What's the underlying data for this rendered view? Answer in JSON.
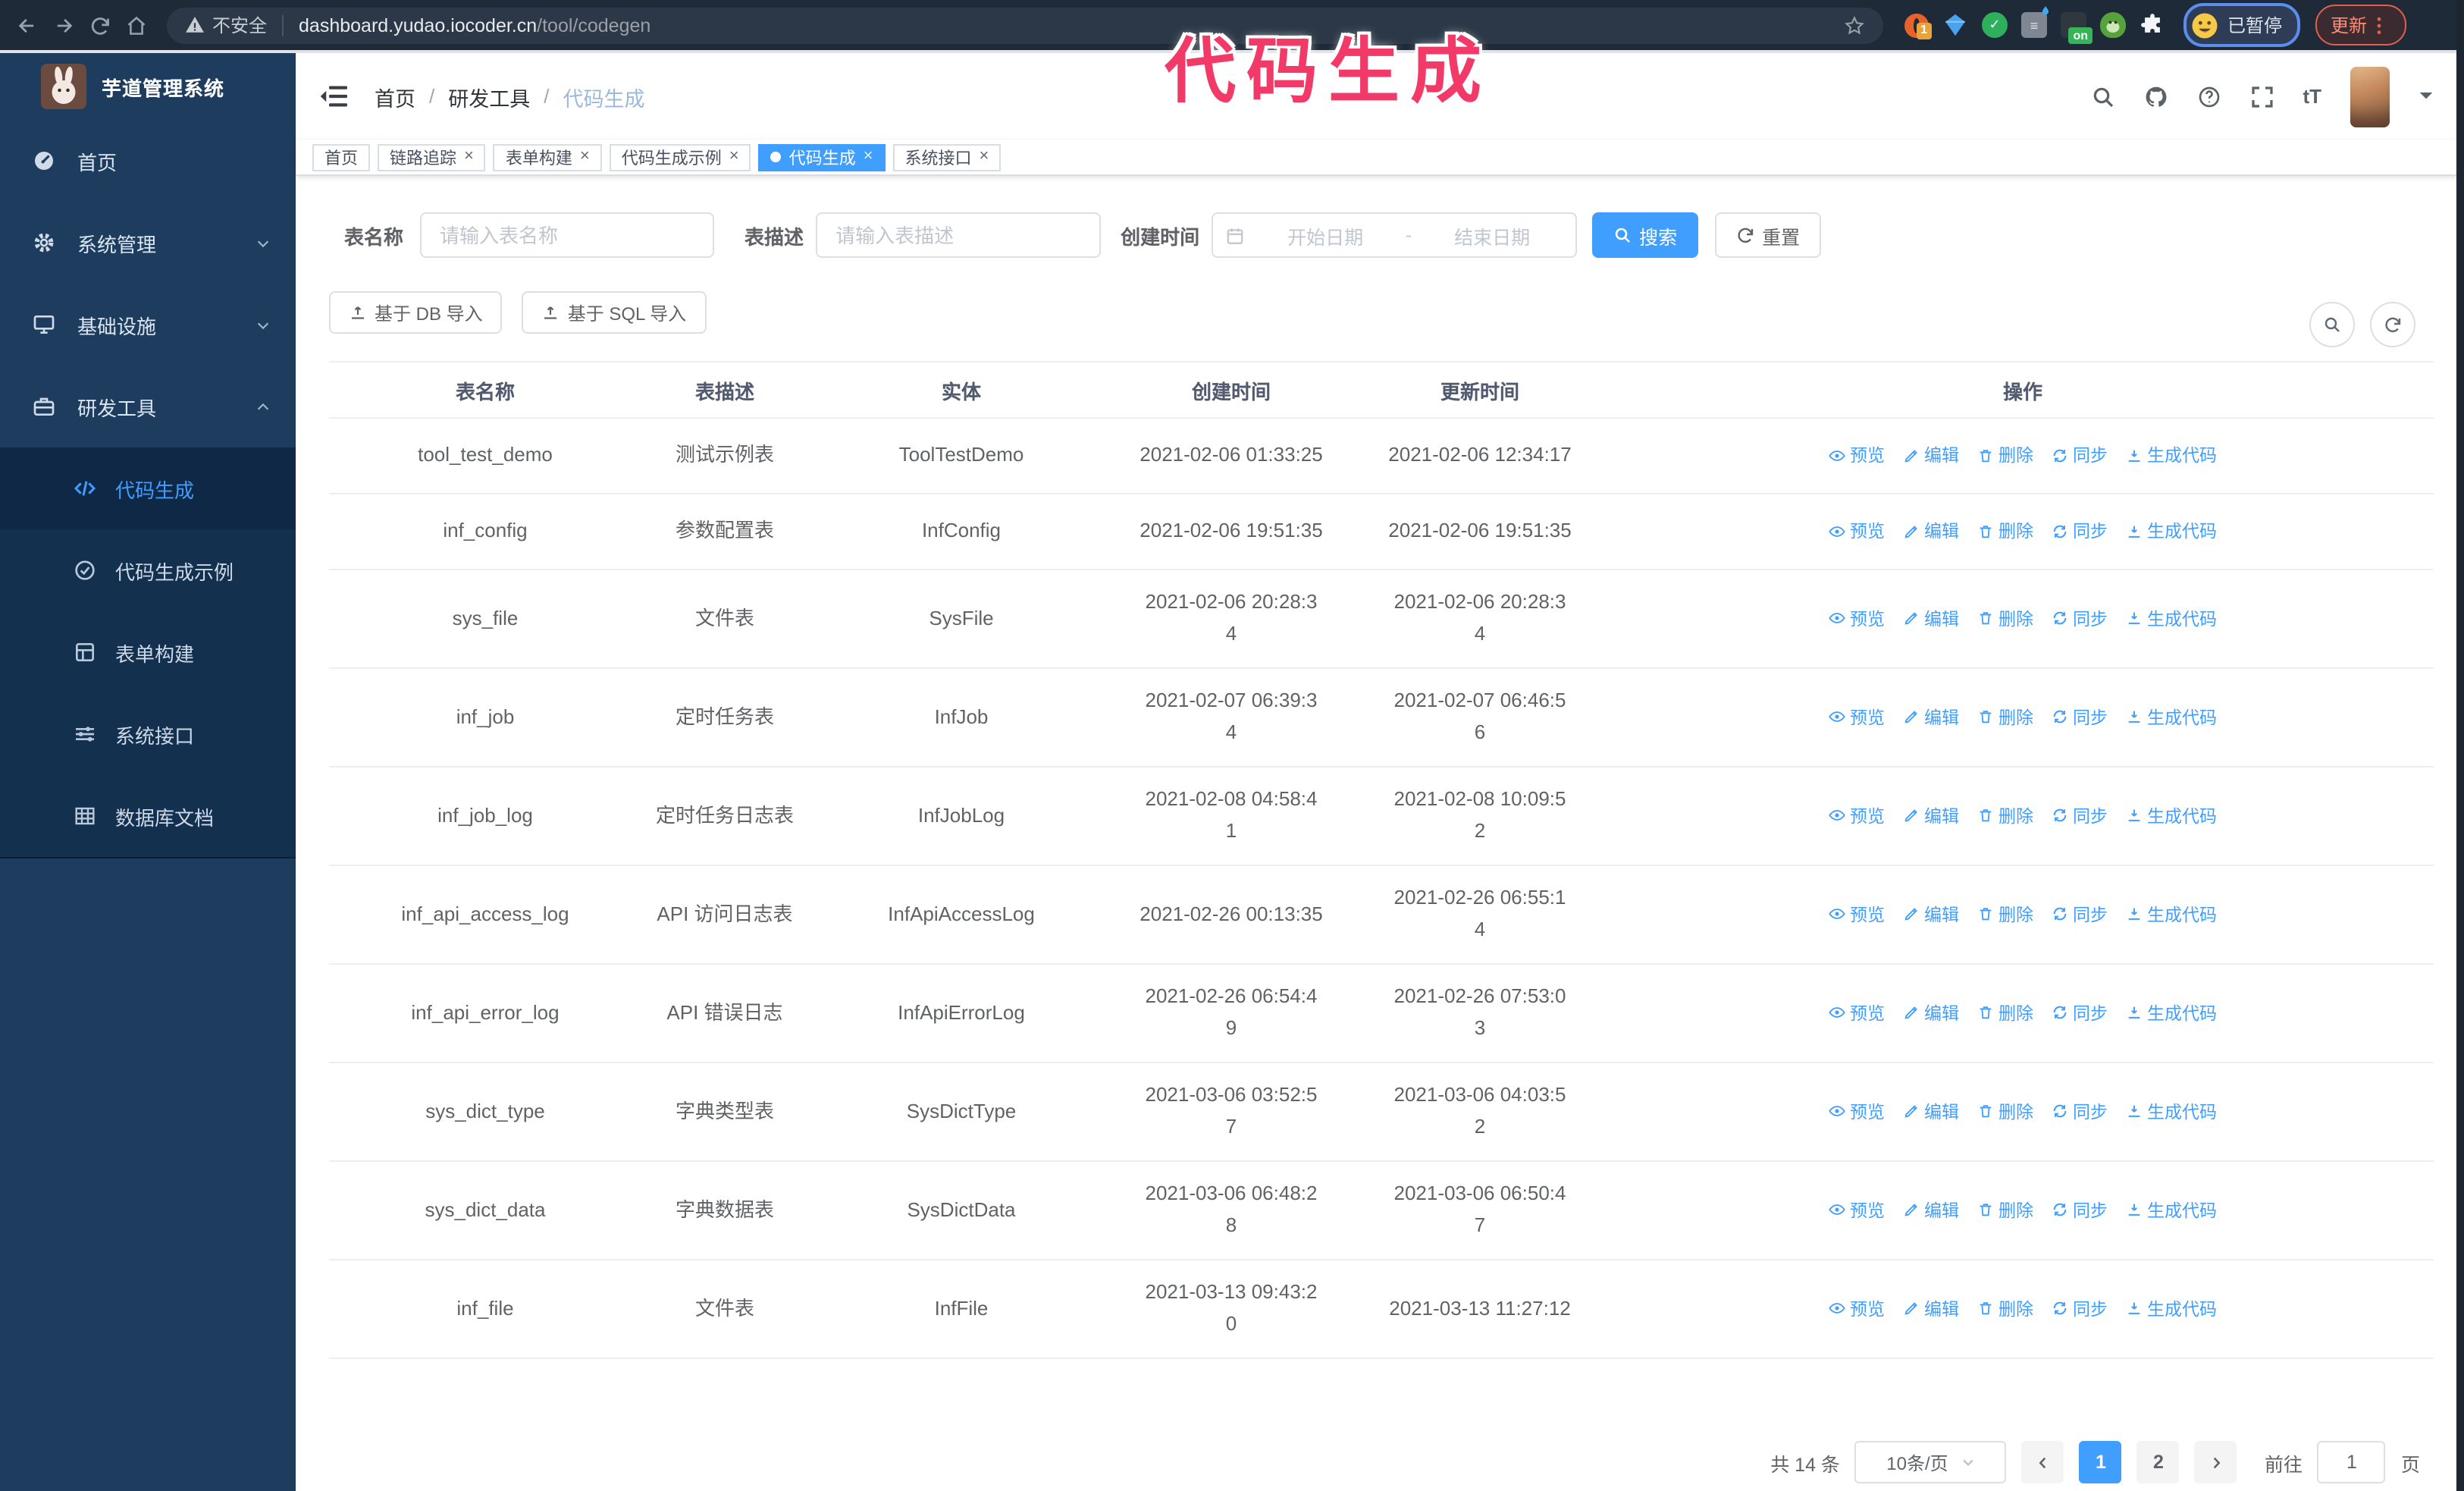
{
  "overlay": {
    "text": "代码生成",
    "color": "#f23a68"
  },
  "browser": {
    "security_label": "不安全",
    "url_host": "dashboard.yudao.iocoder.cn",
    "url_path": "/tool/codegen",
    "profile_chip": "已暂停",
    "update_button": "更新",
    "extensions": [
      {
        "name": "orange-ring-extension-icon",
        "kind": "ring",
        "badge": "1"
      },
      {
        "name": "gem-extension-icon",
        "kind": "gem"
      },
      {
        "name": "green-check-extension-icon",
        "kind": "check",
        "glyph": "✓"
      },
      {
        "name": "sliders-extension-icon",
        "kind": "sliders",
        "glyph": "≡"
      },
      {
        "name": "on-badge-extension-icon",
        "kind": "on",
        "badge": "on"
      },
      {
        "name": "monkey-extension-icon",
        "kind": "monkey"
      },
      {
        "name": "puzzle-extension-icon",
        "kind": "puzzle"
      }
    ]
  },
  "sidebar": {
    "logo_title": "芋道管理系统",
    "items": [
      {
        "label": "首页",
        "icon": "dashboard",
        "arrow": ""
      },
      {
        "label": "系统管理",
        "icon": "gear",
        "arrow": "down"
      },
      {
        "label": "基础设施",
        "icon": "infra",
        "arrow": "down"
      },
      {
        "label": "研发工具",
        "icon": "tool",
        "arrow": "up"
      }
    ],
    "submenu": [
      {
        "label": "代码生成",
        "icon": "code",
        "active": true
      },
      {
        "label": "代码生成示例",
        "icon": "example",
        "active": false
      },
      {
        "label": "表单构建",
        "icon": "form",
        "active": false
      },
      {
        "label": "系统接口",
        "icon": "api",
        "active": false
      },
      {
        "label": "数据库文档",
        "icon": "dbdoc",
        "active": false
      }
    ]
  },
  "header": {
    "breadcrumb": [
      "首页",
      "研发工具",
      "代码生成"
    ],
    "separator": "/"
  },
  "tags": [
    {
      "label": "首页",
      "active": false,
      "closable": false
    },
    {
      "label": "链路追踪",
      "active": false,
      "closable": true
    },
    {
      "label": "表单构建",
      "active": false,
      "closable": true
    },
    {
      "label": "代码生成示例",
      "active": false,
      "closable": true
    },
    {
      "label": "代码生成",
      "active": true,
      "closable": true
    },
    {
      "label": "系统接口",
      "active": false,
      "closable": true
    }
  ],
  "close_glyph": "×",
  "filters": {
    "name_label": "表名称",
    "name_placeholder": "请输入表名称",
    "desc_label": "表描述",
    "desc_placeholder": "请输入表描述",
    "time_label": "创建时间",
    "start_placeholder": "开始日期",
    "range_separator": "-",
    "end_placeholder": "结束日期",
    "search_label": "搜索",
    "reset_label": "重置"
  },
  "toolbar": {
    "import_db": "基于 DB 导入",
    "import_sql": "基于 SQL 导入"
  },
  "table": {
    "columns": [
      "表名称",
      "表描述",
      "实体",
      "创建时间",
      "更新时间",
      "操作"
    ],
    "operations": [
      {
        "label": "预览",
        "icon": "eye",
        "name": "preview-link"
      },
      {
        "label": "编辑",
        "icon": "edit",
        "name": "edit-link"
      },
      {
        "label": "删除",
        "icon": "trash",
        "name": "delete-link"
      },
      {
        "label": "同步",
        "icon": "sync",
        "name": "sync-link"
      },
      {
        "label": "生成代码",
        "icon": "download",
        "name": "generate-code-link"
      }
    ],
    "rows": [
      {
        "name": "tool_test_demo",
        "desc": "测试示例表",
        "entity": "ToolTestDemo",
        "created": [
          "2021-02-06 01:33:25"
        ],
        "updated": [
          "2021-02-06 12:34:17"
        ]
      },
      {
        "name": "inf_config",
        "desc": "参数配置表",
        "entity": "InfConfig",
        "created": [
          "2021-02-06 19:51:35"
        ],
        "updated": [
          "2021-02-06 19:51:35"
        ]
      },
      {
        "name": "sys_file",
        "desc": "文件表",
        "entity": "SysFile",
        "created": [
          "2021-02-06 20:28:3",
          "4"
        ],
        "updated": [
          "2021-02-06 20:28:3",
          "4"
        ]
      },
      {
        "name": "inf_job",
        "desc": "定时任务表",
        "entity": "InfJob",
        "created": [
          "2021-02-07 06:39:3",
          "4"
        ],
        "updated": [
          "2021-02-07 06:46:5",
          "6"
        ]
      },
      {
        "name": "inf_job_log",
        "desc": "定时任务日志表",
        "entity": "InfJobLog",
        "created": [
          "2021-02-08 04:58:4",
          "1"
        ],
        "updated": [
          "2021-02-08 10:09:5",
          "2"
        ]
      },
      {
        "name": "inf_api_access_log",
        "desc": "API 访问日志表",
        "entity": "InfApiAccessLog",
        "created": [
          "2021-02-26 00:13:35"
        ],
        "updated": [
          "2021-02-26 06:55:1",
          "4"
        ]
      },
      {
        "name": "inf_api_error_log",
        "desc": "API 错误日志",
        "entity": "InfApiErrorLog",
        "created": [
          "2021-02-26 06:54:4",
          "9"
        ],
        "updated": [
          "2021-02-26 07:53:0",
          "3"
        ]
      },
      {
        "name": "sys_dict_type",
        "desc": "字典类型表",
        "entity": "SysDictType",
        "created": [
          "2021-03-06 03:52:5",
          "7"
        ],
        "updated": [
          "2021-03-06 04:03:5",
          "2"
        ]
      },
      {
        "name": "sys_dict_data",
        "desc": "字典数据表",
        "entity": "SysDictData",
        "created": [
          "2021-03-06 06:48:2",
          "8"
        ],
        "updated": [
          "2021-03-06 06:50:4",
          "7"
        ]
      },
      {
        "name": "inf_file",
        "desc": "文件表",
        "entity": "InfFile",
        "created": [
          "2021-03-13 09:43:2",
          "0"
        ],
        "updated": [
          "2021-03-13 11:27:12"
        ]
      }
    ]
  },
  "pagination": {
    "total": "共 14 条",
    "page_size": "10条/页",
    "pages": [
      "1",
      "2"
    ],
    "active_page": "1",
    "goto_label": "前往",
    "goto_value": "1",
    "goto_unit": "页"
  },
  "colors": {
    "primary": "#409EFF",
    "sidebar_bg": "#1e3c5e",
    "submenu_bg": "#14304f",
    "chrome_bg": "#1f2a38",
    "overlay_pink": "#f23a68"
  }
}
